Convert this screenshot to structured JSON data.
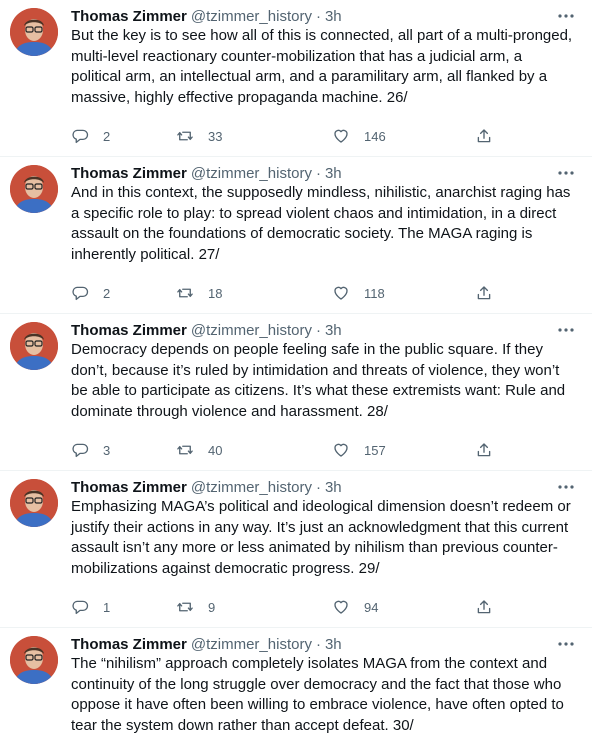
{
  "tweets": [
    {
      "name": "Thomas Zimmer",
      "handle": "@tzimmer_history",
      "dot": "·",
      "time": "3h",
      "text": "But the key is to see how all of this is connected, all part of a multi-pronged, multi-level reactionary counter-mobilization that has a judicial arm, a political arm, an intellectual arm, and a paramilitary arm, all flanked by a massive, highly effective propaganda machine. 26/",
      "replies": "2",
      "retweets": "33",
      "likes": "146"
    },
    {
      "name": "Thomas Zimmer",
      "handle": "@tzimmer_history",
      "dot": "·",
      "time": "3h",
      "text": "And in this context, the supposedly mindless, nihilistic, anarchist raging has a specific role to play: to spread violent chaos and intimidation, in a direct assault on the foundations of democratic society. The MAGA raging is inherently political. 27/",
      "replies": "2",
      "retweets": "18",
      "likes": "118"
    },
    {
      "name": "Thomas Zimmer",
      "handle": "@tzimmer_history",
      "dot": "·",
      "time": "3h",
      "text": "Democracy depends on people feeling safe in the public square. If they don’t, because it’s ruled by intimidation and threats of violence, they won’t be able to participate as citizens. It’s what these extremists want: Rule and dominate through violence and harassment. 28/",
      "replies": "3",
      "retweets": "40",
      "likes": "157"
    },
    {
      "name": "Thomas Zimmer",
      "handle": "@tzimmer_history",
      "dot": "·",
      "time": "3h",
      "text": "Emphasizing MAGA’s political and ideological dimension doesn’t redeem or justify their actions in any way. It’s just an acknowledgment that this current assault isn’t any more or less animated by nihilism than previous counter-mobilizations against democratic progress. 29/",
      "replies": "1",
      "retweets": "9",
      "likes": "94"
    },
    {
      "name": "Thomas Zimmer",
      "handle": "@tzimmer_history",
      "dot": "·",
      "time": "3h",
      "text": "The “nihilism” approach completely isolates MAGA from the context and continuity of the long struggle over democracy and the fact that those who oppose it have often been willing to embrace violence, have often opted to tear the system down rather than accept defeat. 30/",
      "replies": "",
      "retweets": "",
      "likes": ""
    }
  ],
  "colors": {
    "text": "#0f1419",
    "secondary": "#536471",
    "divider": "#eff3f4",
    "avatar_bg": "#c84f3a"
  },
  "icons": {
    "reply": "reply-icon",
    "retweet": "retweet-icon",
    "like": "heart-icon",
    "share": "share-icon",
    "more": "more-icon"
  }
}
